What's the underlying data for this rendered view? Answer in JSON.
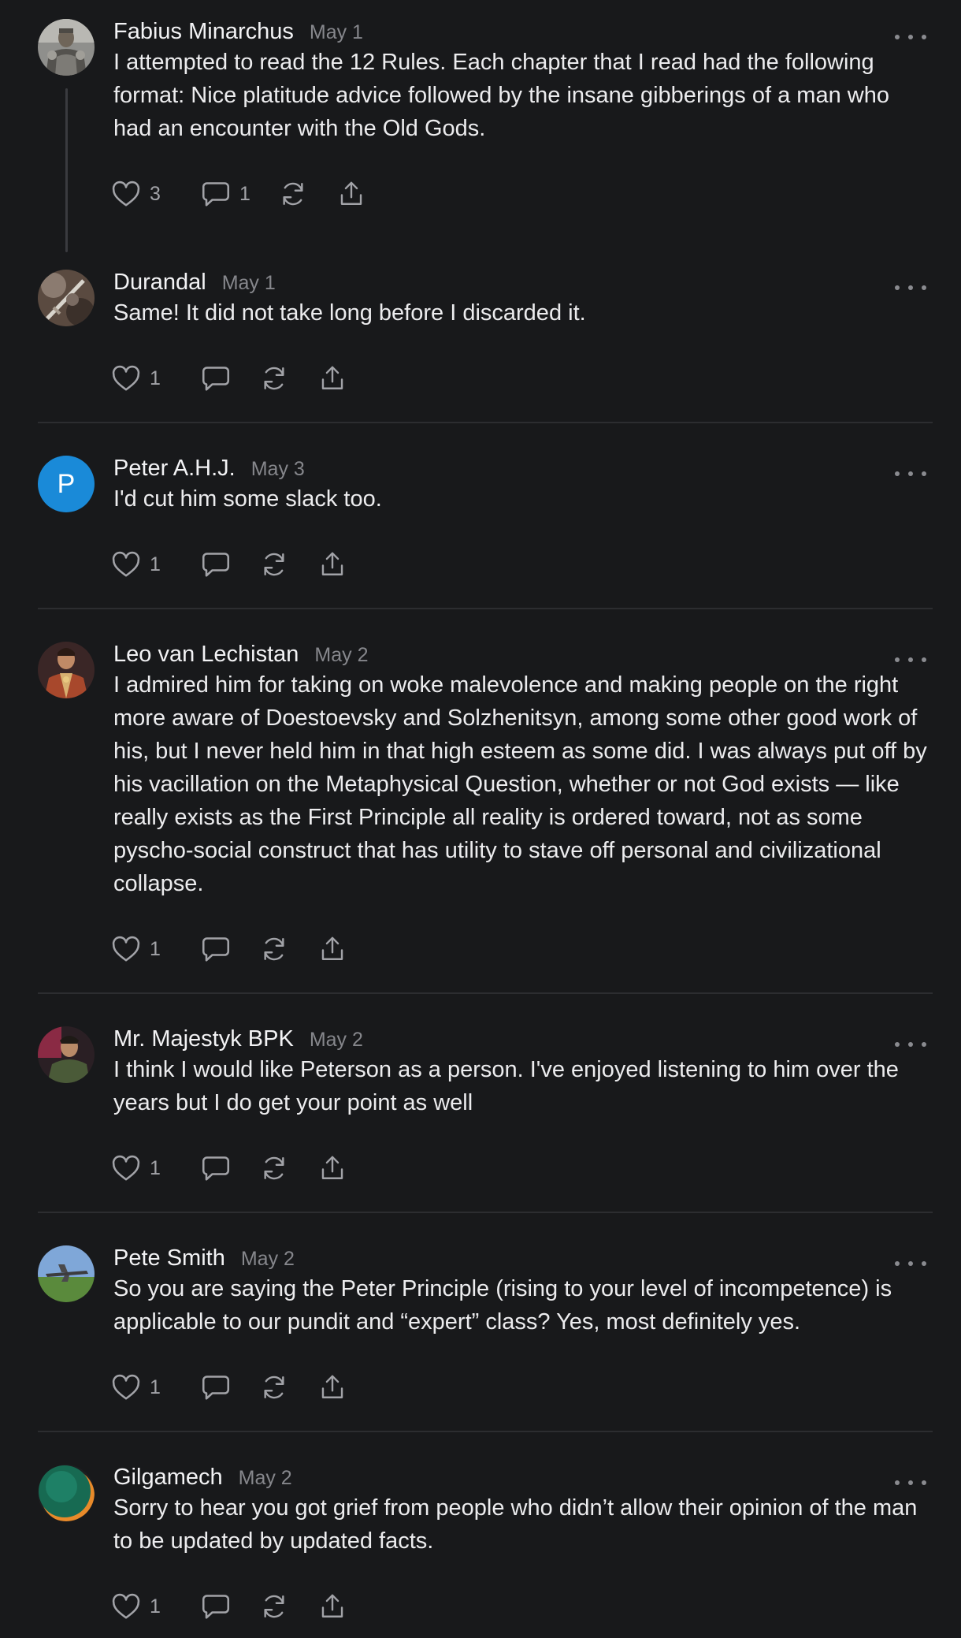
{
  "comments": [
    {
      "author": "Fabius Minarchus",
      "date": "May 1",
      "text": "I attempted to read the 12 Rules. Each chapter that I read had the following format: Nice platitude advice followed by the insane gibberings of a man who had an encounter with the Old Gods.",
      "likes": "3",
      "replies": "1",
      "avatar": "knight-armor-avatar"
    },
    {
      "author": "Durandal",
      "date": "May 1",
      "text": "Same! It did not take long before I discarded it.",
      "likes": "1",
      "replies": "",
      "avatar": "sword-avatar"
    },
    {
      "author": "Peter A.H.J.",
      "date": "May 3",
      "text": "I'd cut him some slack too.",
      "likes": "1",
      "replies": "",
      "avatar_letter": "P",
      "avatar_color": "#1a8ad8"
    },
    {
      "author": "Leo van Lechistan",
      "date": "May 2",
      "text": "I admired him for taking on woke malevolence and making people on the right more aware of Doestoevsky and Solzhenitsyn, among some other good work of his, but I never held him in that high esteem as some did. I was always put off by his vacillation on the Metaphysical Question, whether or not God exists — like really exists as the First Principle all reality is ordered toward, not as some pyscho-social construct that has utility to stave off personal and civilizational collapse.",
      "likes": "1",
      "replies": "",
      "avatar": "portrait-painting-avatar"
    },
    {
      "author": "Mr. Majestyk BPK",
      "date": "May 2",
      "text": "I think I would like Peterson as a person. I've enjoyed listening to him over the years but I do get your point as well",
      "likes": "1",
      "replies": "",
      "avatar": "person-photo-avatar"
    },
    {
      "author": "Pete Smith",
      "date": "May 2",
      "text": "So you are saying the Peter Principle (rising to your level of incompetence) is applicable to our pundit and “expert” class? Yes, most definitely yes.",
      "likes": "1",
      "replies": "",
      "avatar": "airplane-avatar"
    },
    {
      "author": "Gilgamech",
      "date": "May 2",
      "text": "Sorry to hear you got grief from people who didn’t allow their opinion of the man to be updated by updated facts.",
      "likes": "1",
      "replies": "",
      "avatar": "green-circle-avatar"
    }
  ],
  "colors": {
    "background": "#18191b",
    "text": "#ececee",
    "muted": "#86878c",
    "divider": "#2c2d30"
  }
}
